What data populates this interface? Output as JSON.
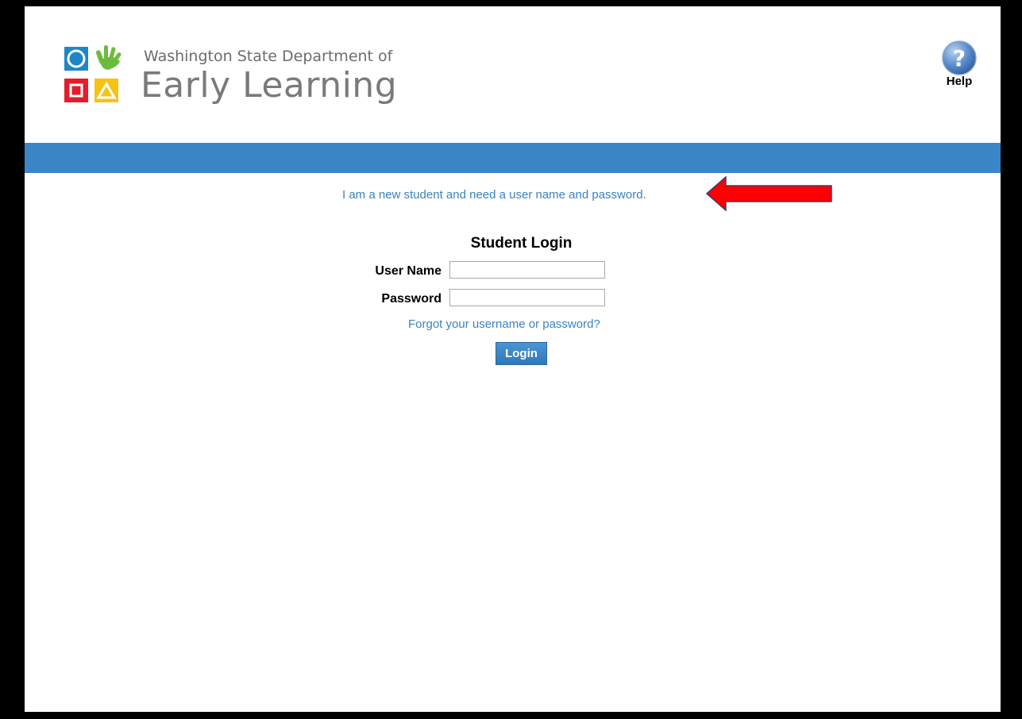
{
  "header": {
    "org_line": "Washington State Department of",
    "org_name": "Early Learning",
    "help_label": "Help"
  },
  "links": {
    "new_student": "I am a new student and need a user name and password.",
    "forgot": "Forgot your username or password?"
  },
  "login_form": {
    "title": "Student Login",
    "username_label": "User Name",
    "username_value": "",
    "password_label": "Password",
    "password_value": "",
    "submit_label": "Login"
  },
  "icons": {
    "logo": "del-logo-icon",
    "help": "question-mark-icon",
    "annotation": "red-arrow-icon"
  },
  "colors": {
    "header_bar": "#3a86c8",
    "link": "#3a82c0",
    "arrow": "#ff0000",
    "button": "#3a86c8"
  }
}
